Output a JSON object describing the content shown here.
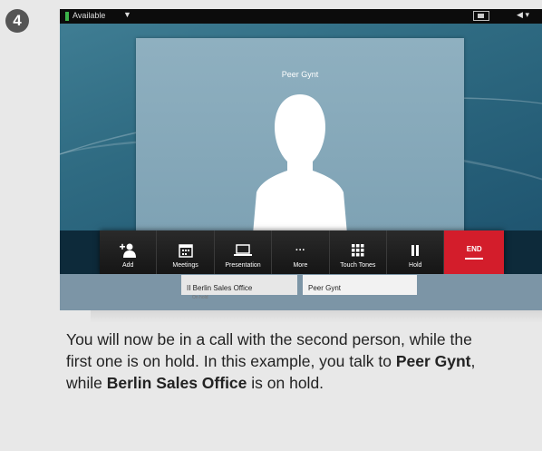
{
  "step_number": "4",
  "status": {
    "availability": "Available",
    "availability_indicator_color": "#3cb34a",
    "dropdown_icon": "caret-down-icon",
    "camera_icon": "self-view-icon",
    "volume_icon": "speaker-icon"
  },
  "video": {
    "participant_name": "Peer Gynt"
  },
  "toolbar": [
    {
      "name": "add",
      "label": "Add",
      "icon": "add-user-icon"
    },
    {
      "name": "meetings",
      "label": "Meetings",
      "icon": "calendar-icon"
    },
    {
      "name": "presentation",
      "label": "Presentation",
      "icon": "laptop-icon"
    },
    {
      "name": "more",
      "label": "More",
      "icon": "ellipsis-icon"
    },
    {
      "name": "touch-tones",
      "label": "Touch Tones",
      "icon": "keypad-icon"
    },
    {
      "name": "hold",
      "label": "Hold",
      "icon": "pause-icon"
    },
    {
      "name": "end",
      "label": "END",
      "icon": "end-call-icon",
      "color": "#d31d2b"
    }
  ],
  "calls": {
    "held": {
      "name": "Berlin Sales Office",
      "status": "On hold"
    },
    "active": {
      "name": "Peer Gynt"
    }
  },
  "caption": {
    "part1": "You will now be in a call with the second person, while the first one is on hold. In this example, you talk to ",
    "bold1": "Peer Gynt",
    "part2": ", while ",
    "bold2": "Berlin Sales Office",
    "part3": " is on hold."
  }
}
